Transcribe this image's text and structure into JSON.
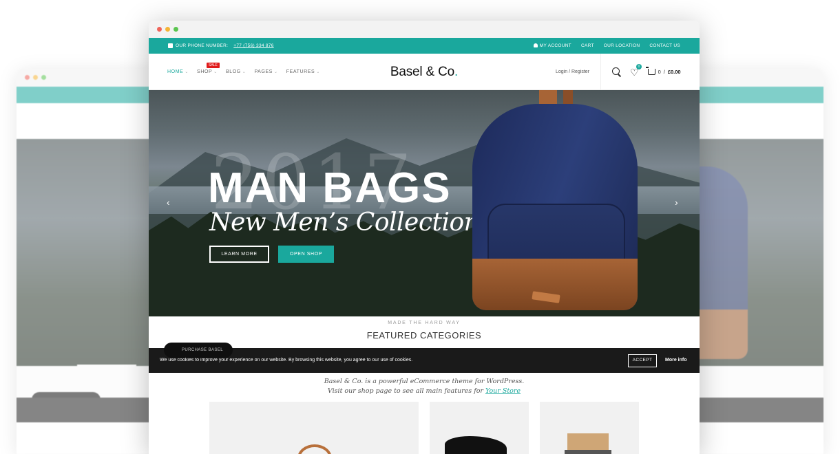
{
  "colors": {
    "accent": "#1aa89d",
    "sale_badge": "#e01b1b",
    "cookie_bar": "#1a1a1a"
  },
  "browser": {
    "dots": [
      "#f0645a",
      "#f5b436",
      "#5ac54f"
    ]
  },
  "topbar": {
    "phone_label": "OUR PHONE NUMBER:",
    "phone_number": "+77 (756) 334 876",
    "links": [
      "MY ACCOUNT",
      "CART",
      "OUR LOCATION",
      "CONTACT US"
    ]
  },
  "nav": {
    "items": [
      {
        "label": "HOME"
      },
      {
        "label": "SHOP",
        "badge": "SALE"
      },
      {
        "label": "BLOG"
      },
      {
        "label": "PAGES"
      },
      {
        "label": "FEATURES"
      }
    ],
    "logo": "Basel & Co",
    "logo_dot": ".",
    "login": "Login / Register",
    "wishlist_count": "0",
    "cart_count": "0",
    "cart_sep": "/",
    "cart_total": "£0.00"
  },
  "hero": {
    "bg_year": "2017",
    "title": "MAN BAGS",
    "subtitle": "New Men’s Collection",
    "btn_learn": "LEARN MORE",
    "btn_shop": "OPEN SHOP",
    "prev": "‹",
    "next": "›"
  },
  "section": {
    "kicker": "MADE THE HARD WAY",
    "heading": "FEATURED CATEGORIES",
    "purchase": "PURCHASE BASEL",
    "desc_line1": "Basel & Co. is a powerful eCommerce theme for WordPress.",
    "desc_line2": "Visit our shop page to see all main features for",
    "desc_link": "Your Store"
  },
  "cookie": {
    "message": "We use cookies to improve your experience on our website. By browsing this website, you agree to our use of cookies.",
    "accept": "ACCEPT",
    "more": "More info"
  }
}
